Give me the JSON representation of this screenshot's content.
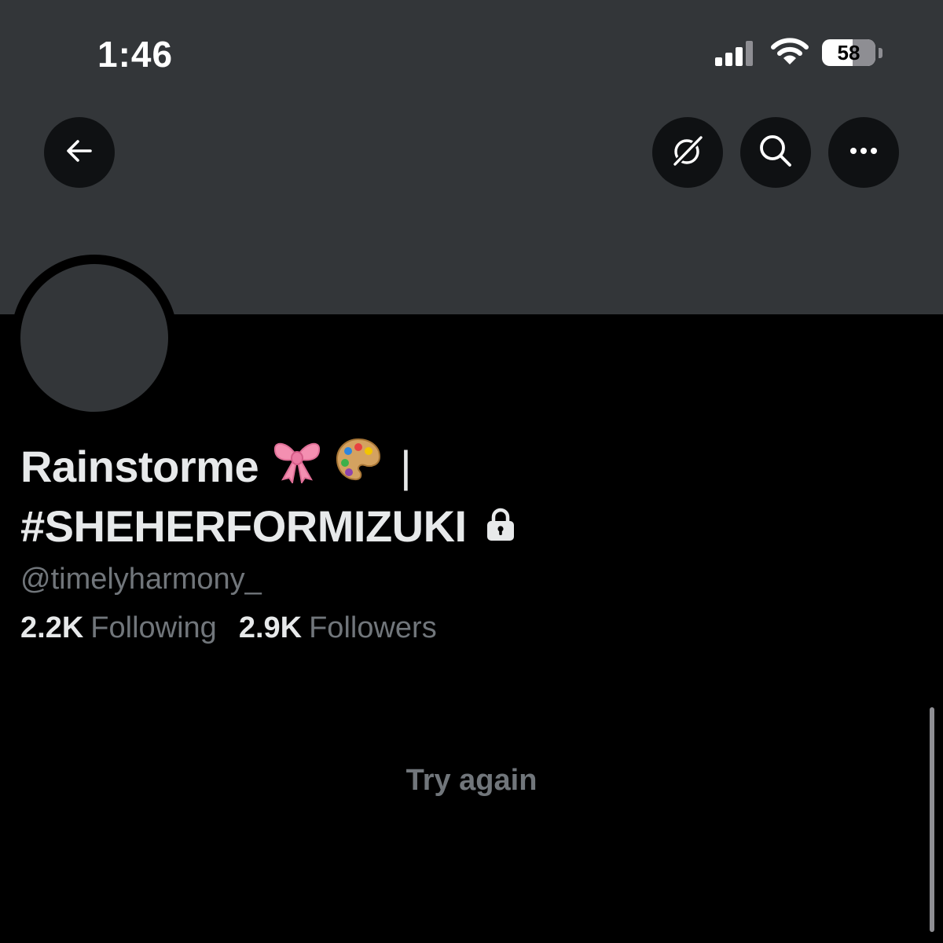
{
  "status_bar": {
    "time": "1:46",
    "battery_level": "58",
    "battery_fraction": 0.58,
    "signal_icon": "cellular-signal-icon",
    "wifi_icon": "wifi-icon"
  },
  "header": {
    "back_icon": "arrow-left-icon",
    "grok_icon": "grok-icon",
    "search_icon": "search-icon",
    "more_icon": "more-dots-icon",
    "button_bg": "#0f1113",
    "banner_color": "#333639"
  },
  "profile": {
    "display_name_line1": "Rainstorme",
    "name_emojis": [
      "ribbon-bow-emoji",
      "artist-palette-emoji"
    ],
    "separator": "|",
    "display_name_line2": "#SHEHERFORMIZUKI",
    "protected_icon": "lock-icon",
    "handle": "@timelyharmony_",
    "following_count": "2.2K",
    "following_label": "Following",
    "followers_count": "2.9K",
    "followers_label": "Followers"
  },
  "content": {
    "try_again_label": "Try again"
  },
  "colors": {
    "background": "#000000",
    "primary_text": "#e7e9ea",
    "secondary_text": "#71767b"
  }
}
